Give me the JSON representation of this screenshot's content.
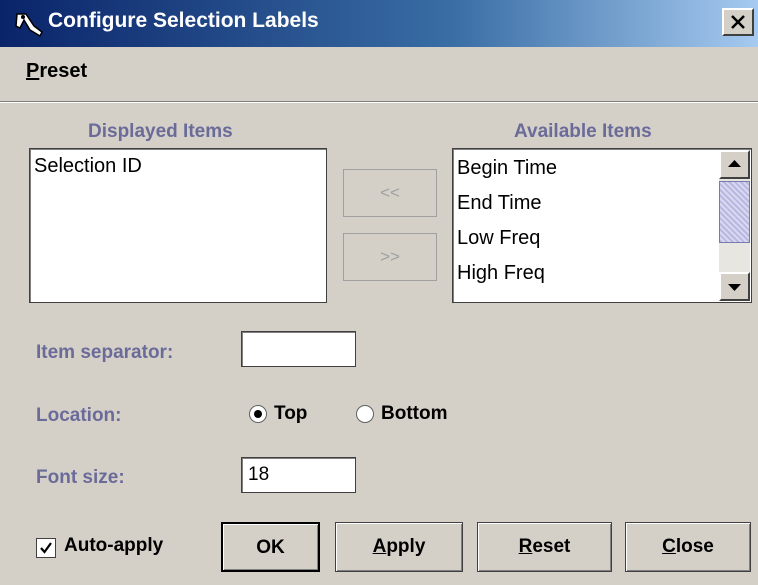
{
  "window": {
    "title": "Configure Selection Labels"
  },
  "menu": {
    "preset_first": "P",
    "preset_rest": "reset"
  },
  "displayed": {
    "header": "Displayed Items",
    "items": [
      "Selection ID"
    ]
  },
  "available": {
    "header": "Available Items",
    "items": [
      "Begin Time",
      "End Time",
      "Low Freq",
      "High Freq"
    ]
  },
  "move_buttons": {
    "add": "<<",
    "remove": ">>"
  },
  "fields": {
    "separator_label": "Item separator:",
    "separator_value": "",
    "location_label": "Location:",
    "location_options": [
      "Top",
      "Bottom"
    ],
    "location_selected": "Top",
    "font_size_label": "Font size:",
    "font_size_value": "18"
  },
  "footer": {
    "auto_apply_label": "Auto-apply",
    "auto_apply_checked": true,
    "ok_label": "OK",
    "apply_first": "A",
    "apply_rest": "pply",
    "reset_first": "R",
    "reset_rest": "eset",
    "close_first": "C",
    "close_rest": "lose"
  },
  "colors": {
    "title_bar": "#0a246a",
    "label_text": "#6b6b9a",
    "dialog_bg": "#d4d0c8"
  },
  "icons": {
    "app": "java-duke-icon",
    "close": "close-x-icon",
    "scroll_up": "arrow-up-icon",
    "scroll_down": "arrow-down-icon",
    "check": "checkmark-icon"
  }
}
